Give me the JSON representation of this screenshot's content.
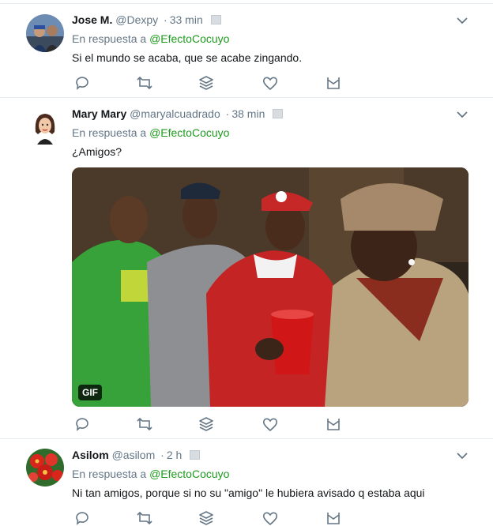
{
  "tweets": [
    {
      "name": "Jose M.",
      "handle": "@Dexpy",
      "separator": "·",
      "time": "33 min",
      "reply_prefix": "En respuesta a",
      "reply_to": "@EfectoCocuyo",
      "text": "Si el mundo se acaba, que se acabe zingando."
    },
    {
      "name": "Mary Mary",
      "handle": "@maryalcuadrado",
      "separator": "·",
      "time": "38 min",
      "reply_prefix": "En respuesta a",
      "reply_to": "@EfectoCocuyo",
      "text": "¿Amigos?",
      "media_badge": "GIF"
    },
    {
      "name": "Asilom",
      "handle": "@asilom",
      "separator": "·",
      "time": "2 h",
      "reply_prefix": "En respuesta a",
      "reply_to": "@EfectoCocuyo",
      "text": "Ni tan amigos, porque si no su \"amigo\" le hubiera avisado q estaba aqui"
    }
  ],
  "colors": {
    "link": "#1d9b1d",
    "icon": "#657786",
    "divider": "#e6ecf0"
  },
  "icons": [
    "reply-icon",
    "retweet-icon",
    "stack-icon",
    "like-icon",
    "message-icon",
    "chevron-down-icon"
  ]
}
